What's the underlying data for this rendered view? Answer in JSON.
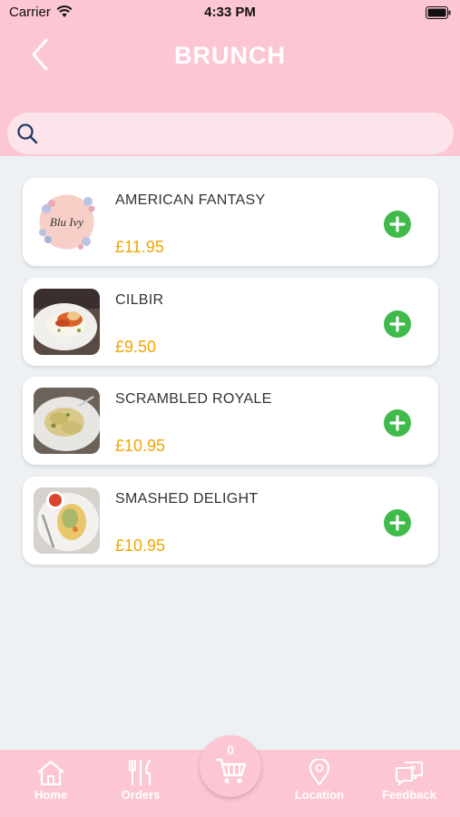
{
  "status": {
    "carrier": "Carrier",
    "time": "4:33 PM"
  },
  "header": {
    "title": "BRUNCH",
    "back_icon": "chevron-left-icon"
  },
  "search": {
    "placeholder": "",
    "value": "",
    "icon": "search-icon"
  },
  "items": [
    {
      "name": "AMERICAN FANTASY",
      "price": "£11.95",
      "image": "blu-ivy-logo"
    },
    {
      "name": "CILBIR",
      "price": "£9.50",
      "image": "cilbir-dish"
    },
    {
      "name": "SCRAMBLED ROYALE",
      "price": "£10.95",
      "image": "scrambled-royale-dish"
    },
    {
      "name": "SMASHED DELIGHT",
      "price": "£10.95",
      "image": "smashed-delight-dish"
    }
  ],
  "cart": {
    "count": "0",
    "icon": "cart-icon"
  },
  "tabs": [
    {
      "label": "Home",
      "icon": "home-icon"
    },
    {
      "label": "Orders",
      "icon": "cutlery-icon"
    },
    {
      "label": "Location",
      "icon": "location-pin-icon"
    },
    {
      "label": "Feedback",
      "icon": "feedback-icon"
    }
  ],
  "colors": {
    "brand_pink": "#fcc6d3",
    "search_bg": "#fde4ea",
    "price": "#f0a500",
    "add": "#3fba4b",
    "background": "#eef1f4"
  }
}
